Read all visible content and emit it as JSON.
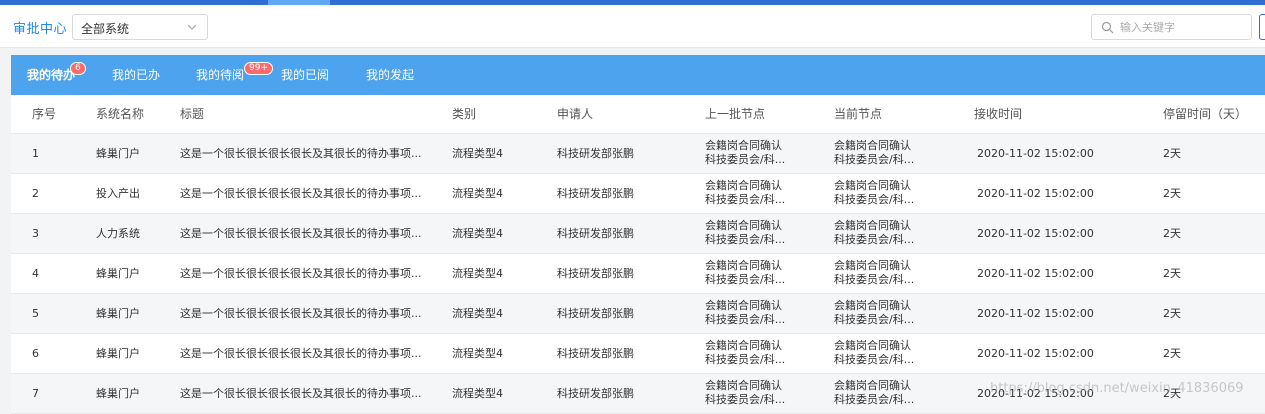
{
  "header": {
    "brand": "审批中心",
    "system_select": "全部系统",
    "search_placeholder": "输入关键字"
  },
  "tabs": [
    {
      "label": "我的待办",
      "badge": "6",
      "active": true
    },
    {
      "label": "我的已办",
      "badge": "",
      "active": false
    },
    {
      "label": "我的待阅",
      "badge": "99+",
      "active": false
    },
    {
      "label": "我的已阅",
      "badge": "",
      "active": false
    },
    {
      "label": "我的发起",
      "badge": "",
      "active": false
    }
  ],
  "table": {
    "columns": [
      "序号",
      "系统名称",
      "标题",
      "类别",
      "申请人",
      "上一批节点",
      "当前节点",
      "接收时间",
      "停留时间（天）"
    ],
    "rows": [
      {
        "no": "1",
        "system": "蜂巢门户",
        "title": "这是一个很长很长很长很长及其很长的待办事项...",
        "category": "流程类型4",
        "applicant": "科技研发部张鹏",
        "prev_node_1": "会籍岗合同确认",
        "prev_node_2": "科技委员会/科...",
        "cur_node_1": "会籍岗合同确认",
        "cur_node_2": "科技委员会/科...",
        "received": "2020-11-02 15:02:00",
        "stay": "2天"
      },
      {
        "no": "2",
        "system": "投入产出",
        "title": "这是一个很长很长很长很长及其很长的待办事项...",
        "category": "流程类型4",
        "applicant": "科技研发部张鹏",
        "prev_node_1": "会籍岗合同确认",
        "prev_node_2": "科技委员会/科...",
        "cur_node_1": "会籍岗合同确认",
        "cur_node_2": "科技委员会/科...",
        "received": "2020-11-02 15:02:00",
        "stay": "2天"
      },
      {
        "no": "3",
        "system": "人力系统",
        "title": "这是一个很长很长很长很长及其很长的待办事项...",
        "category": "流程类型4",
        "applicant": "科技研发部张鹏",
        "prev_node_1": "会籍岗合同确认",
        "prev_node_2": "科技委员会/科...",
        "cur_node_1": "会籍岗合同确认",
        "cur_node_2": "科技委员会/科...",
        "received": "2020-11-02 15:02:00",
        "stay": "2天"
      },
      {
        "no": "4",
        "system": "蜂巢门户",
        "title": "这是一个很长很长很长很长及其很长的待办事项...",
        "category": "流程类型4",
        "applicant": "科技研发部张鹏",
        "prev_node_1": "会籍岗合同确认",
        "prev_node_2": "科技委员会/科...",
        "cur_node_1": "会籍岗合同确认",
        "cur_node_2": "科技委员会/科...",
        "received": "2020-11-02 15:02:00",
        "stay": "2天"
      },
      {
        "no": "5",
        "system": "蜂巢门户",
        "title": "这是一个很长很长很长很长及其很长的待办事项...",
        "category": "流程类型4",
        "applicant": "科技研发部张鹏",
        "prev_node_1": "会籍岗合同确认",
        "prev_node_2": "科技委员会/科...",
        "cur_node_1": "会籍岗合同确认",
        "cur_node_2": "科技委员会/科...",
        "received": "2020-11-02 15:02:00",
        "stay": "2天"
      },
      {
        "no": "6",
        "system": "蜂巢门户",
        "title": "这是一个很长很长很长很长及其很长的待办事项...",
        "category": "流程类型4",
        "applicant": "科技研发部张鹏",
        "prev_node_1": "会籍岗合同确认",
        "prev_node_2": "科技委员会/科...",
        "cur_node_1": "会籍岗合同确认",
        "cur_node_2": "科技委员会/科...",
        "received": "2020-11-02 15:02:00",
        "stay": "2天"
      },
      {
        "no": "7",
        "system": "蜂巢门户",
        "title": "这是一个很长很长很长很长及其很长的待办事项...",
        "category": "流程类型4",
        "applicant": "科技研发部张鹏",
        "prev_node_1": "会籍岗合同确认",
        "prev_node_2": "科技委员会/科...",
        "cur_node_1": "会籍岗合同确认",
        "cur_node_2": "科技委员会/科...",
        "received": "2020-11-02 15:02:00",
        "stay": "2天"
      }
    ]
  },
  "watermark": "https://blog.csdn.net/weixin_41836069",
  "colors": {
    "accent": "#1e88e5",
    "tab_bar": "#4ea3ef",
    "badge": "#ff6b6b"
  }
}
